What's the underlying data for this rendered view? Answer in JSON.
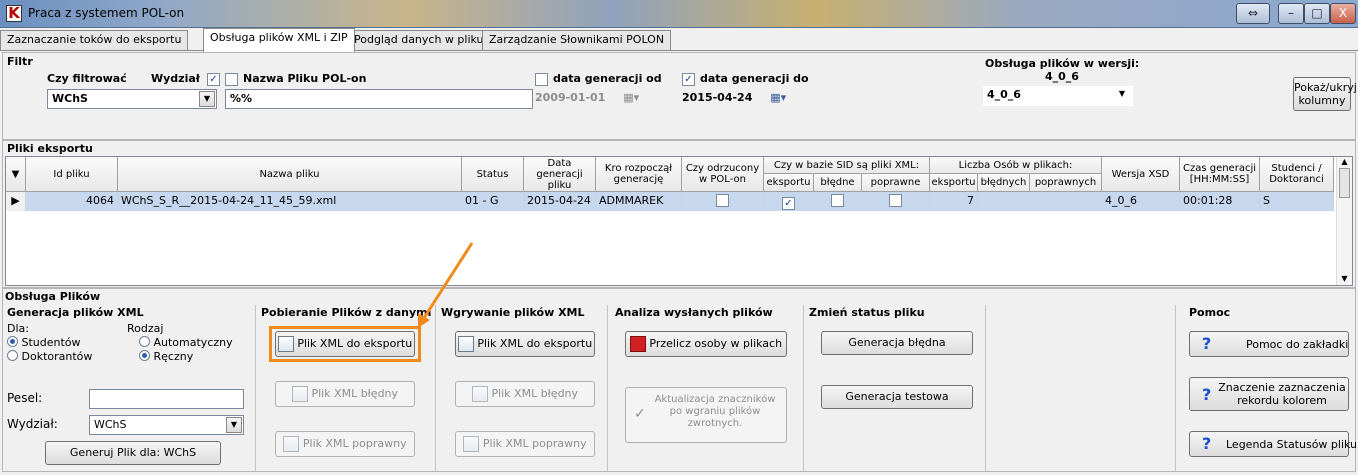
{
  "window": {
    "title": "Praca z systemem POL-on",
    "buttons": [
      "⇔",
      "–",
      "□",
      "X"
    ]
  },
  "tabs": [
    "Zaznaczanie toków do eksportu",
    "Obsługa plików XML i ZIP",
    "Podgląd danych w pliku",
    "Zarządzanie Słownikami POLON"
  ],
  "filter": {
    "title": "Filtr",
    "czy_filtrowac": "Czy filtrować",
    "wydzial_label": "Wydział",
    "wydzial_checked": true,
    "wydzial_value": "WChS",
    "nazwa_label": "Nazwa Pliku POL-on",
    "nazwa_checked": false,
    "nazwa_value": "%%",
    "data_od_label": "data generacji od",
    "data_od_checked": false,
    "data_od_value": "2009-01-01",
    "data_do_label": "data generacji do",
    "data_do_checked": true,
    "data_do_value": "2015-04-24",
    "wersja_label": "Obsługa plików w wersji:",
    "wersja_sub": "4_0_6",
    "wersja_value": "4_0_6",
    "pokaz_button": "Pokaż/ukryj kolumny"
  },
  "files": {
    "title": "Pliki eksportu",
    "headers": {
      "id": "Id pliku",
      "name": "Nazwa pliku",
      "status": "Status",
      "data": "Data generacji pliku",
      "kto": "Kro rozpoczął generację",
      "odrz": "Czy odrzucony w POL-on",
      "sid_group": "Czy w bazie SID są pliki XML:",
      "sid_eks": "eksportu",
      "sid_bl": "błędne",
      "sid_pop": "poprawne",
      "os_group": "Liczba Osób w plikach:",
      "os_eks": "eksportu",
      "os_bl": "błędnych",
      "os_pop": "poprawnych",
      "xsd": "Wersja XSD",
      "czas": "Czas generacji [HH:MM:SS]",
      "stud": "Studenci / Doktoranci"
    },
    "rows": [
      {
        "id": "4064",
        "name": "WChS_S_R__2015-04-24_11_45_59.xml",
        "status": "01 - G",
        "data": "2015-04-24",
        "kto": "ADMMAREK",
        "odrz": false,
        "sid_eks": true,
        "sid_bl": false,
        "sid_pop": false,
        "os_eks": "7",
        "os_bl": "",
        "os_pop": "",
        "xsd": "4_0_6",
        "czas": "00:01:28",
        "stud": "S"
      }
    ]
  },
  "obsluga": {
    "title": "Obsługa Plików",
    "gen": {
      "title": "Generacja plików XML",
      "dla": "Dla:",
      "studentow": "Studentów",
      "doktorantow": "Doktorantów",
      "rodzaj": "Rodzaj",
      "automatyczny": "Automatyczny",
      "reczny": "Ręczny",
      "pesel": "Pesel:",
      "pesel_value": "",
      "wydzial": "Wydział:",
      "wydzial_value": "WChS",
      "generuj": "Generuj Plik dla: WChS"
    },
    "pobieranie": {
      "title": "Pobieranie Plików z danymi",
      "b1": "Plik XML do eksportu",
      "b2": "Plik XML błędny",
      "b3": "Plik XML poprawny"
    },
    "wgrywanie": {
      "title": "Wgrywanie plików XML",
      "b1": "Plik XML do eksportu",
      "b2": "Plik XML błędny",
      "b3": "Plik XML poprawny"
    },
    "analiza": {
      "title": "Analiza wysłanych plików",
      "b1": "Przelicz osoby w plikach",
      "b2": "Aktualizacja znaczników po wgraniu plików zwrotnych."
    },
    "status": {
      "title": "Zmień status pliku",
      "b1": "Generacja błędna",
      "b2": "Generacja testowa"
    },
    "pomoc": {
      "title": "Pomoc",
      "b1": "Pomoc do zakładki",
      "b2": "Znaczenie zaznaczenia rekordu kolorem",
      "b3": "Legenda Statusów pliku"
    }
  },
  "colors": {
    "highlight": "#f08a1c",
    "selected_row": "#c7d7ee"
  }
}
